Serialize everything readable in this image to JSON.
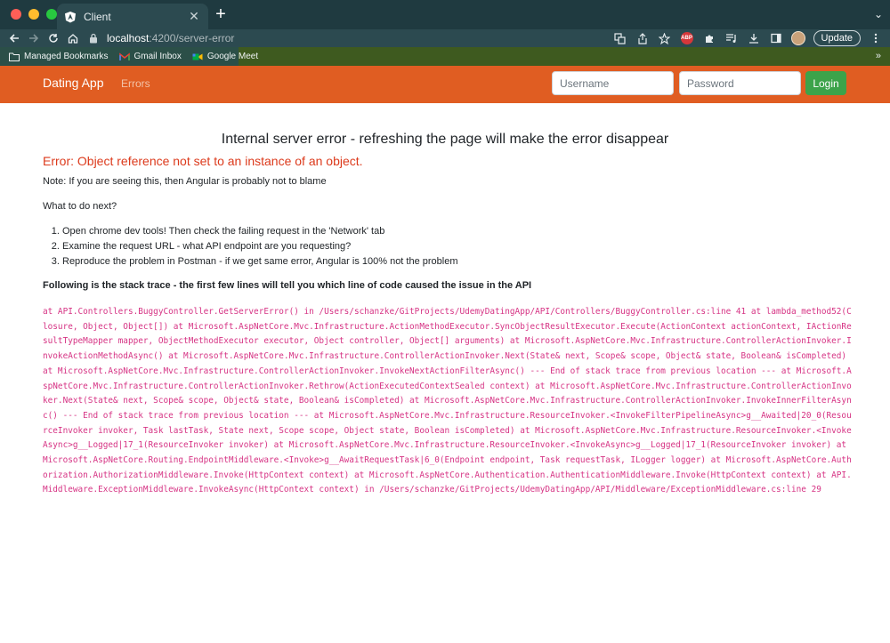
{
  "browser": {
    "tab_title": "Client",
    "tab_close": "✕",
    "new_tab": "+",
    "tab_search": "⌄",
    "url_host": "localhost",
    "url_path": ":4200/server-error",
    "update_label": "Update",
    "abp_label": "ABP",
    "bookmarks": [
      {
        "label": "Managed Bookmarks",
        "icon": "folder-icon"
      },
      {
        "label": "Gmail Inbox",
        "icon": "gmail-icon"
      },
      {
        "label": "Google Meet",
        "icon": "meet-icon"
      }
    ],
    "bookmarks_more": "»"
  },
  "navbar": {
    "brand": "Dating App",
    "link_errors": "Errors",
    "username_placeholder": "Username",
    "password_placeholder": "Password",
    "login_label": "Login",
    "colors": {
      "navbar": "#e05d22",
      "login": "#3ca34a"
    }
  },
  "page": {
    "title": "Internal server error - refreshing the page will make the error disappear",
    "error": "Error: Object reference not set to an instance of an object.",
    "note": "Note: If you are seeing this, then Angular is probably not to blame",
    "next": "What to do next?",
    "steps": [
      "Open chrome dev tools! Then check the failing request in the 'Network' tab",
      "Examine the request URL - what API endpoint are you requesting?",
      "Reproduce the problem in Postman - if we get same error, Angular is 100% not the problem"
    ],
    "stack_heading": "Following is the stack trace - the first few lines will tell you which line of code caused the issue in the API",
    "stack_trace": "at API.Controllers.BuggyController.GetServerError() in /Users/schanzke/GitProjects/UdemyDatingApp/API/Controllers/BuggyController.cs:line 41 at lambda_method52(Closure, Object, Object[]) at Microsoft.AspNetCore.Mvc.Infrastructure.ActionMethodExecutor.SyncObjectResultExecutor.Execute(ActionContext actionContext, IActionResultTypeMapper mapper, ObjectMethodExecutor executor, Object controller, Object[] arguments) at Microsoft.AspNetCore.Mvc.Infrastructure.ControllerActionInvoker.InvokeActionMethodAsync() at Microsoft.AspNetCore.Mvc.Infrastructure.ControllerActionInvoker.Next(State& next, Scope& scope, Object& state, Boolean& isCompleted) at Microsoft.AspNetCore.Mvc.Infrastructure.ControllerActionInvoker.InvokeNextActionFilterAsync() --- End of stack trace from previous location --- at Microsoft.AspNetCore.Mvc.Infrastructure.ControllerActionInvoker.Rethrow(ActionExecutedContextSealed context) at Microsoft.AspNetCore.Mvc.Infrastructure.ControllerActionInvoker.Next(State& next, Scope& scope, Object& state, Boolean& isCompleted) at Microsoft.AspNetCore.Mvc.Infrastructure.ControllerActionInvoker.InvokeInnerFilterAsync() --- End of stack trace from previous location --- at Microsoft.AspNetCore.Mvc.Infrastructure.ResourceInvoker.<InvokeFilterPipelineAsync>g__Awaited|20_0(ResourceInvoker invoker, Task lastTask, State next, Scope scope, Object state, Boolean isCompleted) at Microsoft.AspNetCore.Mvc.Infrastructure.ResourceInvoker.<InvokeAsync>g__Logged|17_1(ResourceInvoker invoker) at Microsoft.AspNetCore.Mvc.Infrastructure.ResourceInvoker.<InvokeAsync>g__Logged|17_1(ResourceInvoker invoker) at Microsoft.AspNetCore.Routing.EndpointMiddleware.<Invoke>g__AwaitRequestTask|6_0(Endpoint endpoint, Task requestTask, ILogger logger) at Microsoft.AspNetCore.Authorization.AuthorizationMiddleware.Invoke(HttpContext context) at Microsoft.AspNetCore.Authentication.AuthenticationMiddleware.Invoke(HttpContext context) at API.Middleware.ExceptionMiddleware.InvokeAsync(HttpContext context) in /Users/schanzke/GitProjects/UdemyDatingApp/API/Middleware/ExceptionMiddleware.cs:line 29"
  }
}
